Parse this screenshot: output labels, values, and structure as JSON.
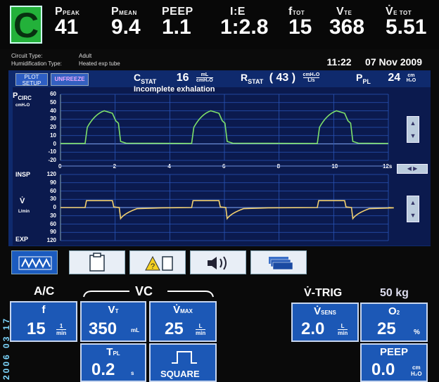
{
  "mode_badge": "C",
  "top_params": [
    {
      "label": "P",
      "sub": "PEAK",
      "value": "41"
    },
    {
      "label": "P",
      "sub": "MEAN",
      "value": "9.4"
    },
    {
      "label": "PEEP",
      "sub": "",
      "value": "1.1"
    },
    {
      "label": "I:E",
      "sub": "",
      "value": "1:2.8"
    },
    {
      "label": "f",
      "sub": "TOT",
      "value": "15"
    },
    {
      "label": "V",
      "sub": "TE",
      "value": "368"
    },
    {
      "label": "V̇",
      "sub": "E TOT",
      "value": "5.51"
    }
  ],
  "info": {
    "circuit_type_label": "Circuit Type:",
    "circuit_type_value": "Adult",
    "humidification_label": "Humidification Type:",
    "humidification_value": "Heated exp tube",
    "time": "11:22",
    "date": "07 Nov 2009"
  },
  "graph_toolbar": {
    "plot_setup": "PLOT SETUP",
    "unfreeze": "UNFREEZE"
  },
  "stats": {
    "cstat_label": "C",
    "cstat_sub": "STAT",
    "cstat_value": "16",
    "cstat_unit_top": "mL",
    "cstat_unit_bottom": "cmH₂O",
    "rstat_label": "R",
    "rstat_sub": "STAT",
    "rstat_value": "( 43 )",
    "rstat_unit_top": "cmH₂O",
    "rstat_unit_bottom": "L/s",
    "ppl_label": "P",
    "ppl_sub": "PL",
    "ppl_value": "24",
    "ppl_unit_top": "cm",
    "ppl_unit_bottom": "H₂O",
    "message": "Incomplete exhalation"
  },
  "pressure_graph": {
    "ylabel": "P",
    "ylabel_sub": "CIRC",
    "yunit": "cmH₂O",
    "yticks": [
      "60",
      "50",
      "40",
      "30",
      "20",
      "10",
      "0",
      "-10",
      "-20"
    ],
    "xticks": [
      "0",
      "2",
      "4",
      "6",
      "8",
      "10",
      "12s"
    ]
  },
  "flow_graph": {
    "insp_label": "INSP",
    "exp_label": "EXP",
    "ylabel": "V̇",
    "yunit": "L/min",
    "yticks": [
      "120",
      "90",
      "60",
      "30",
      "0",
      "30",
      "60",
      "90",
      "120"
    ]
  },
  "settings": {
    "mode_label": "A/C",
    "type_label": "VC",
    "trigger_label": "V̇-TRIG",
    "weight": "50 kg",
    "f": {
      "name": "f",
      "value": "15",
      "unit_top": "1",
      "unit_bottom": "min"
    },
    "vt": {
      "name": "V",
      "sub": "T",
      "value": "350",
      "unit": "mL"
    },
    "vmax": {
      "name": "V̇",
      "sub": "MAX",
      "value": "25",
      "unit_top": "L",
      "unit_bottom": "min"
    },
    "vsens": {
      "name": "V̇",
      "sub": "SENS",
      "value": "2.0",
      "unit_top": "L",
      "unit_bottom": "min"
    },
    "o2": {
      "name": "O",
      "sub": "2",
      "value": "25",
      "unit": "%"
    },
    "tpl": {
      "name": "T",
      "sub": "PL",
      "value": "0.2",
      "unit": "s"
    },
    "waveform": {
      "value": "SQUARE"
    },
    "peep": {
      "name": "PEEP",
      "value": "0.0",
      "unit_top": "cm",
      "unit_bottom": "H₂O"
    }
  },
  "photo_datestamp": "2006 03 17"
}
